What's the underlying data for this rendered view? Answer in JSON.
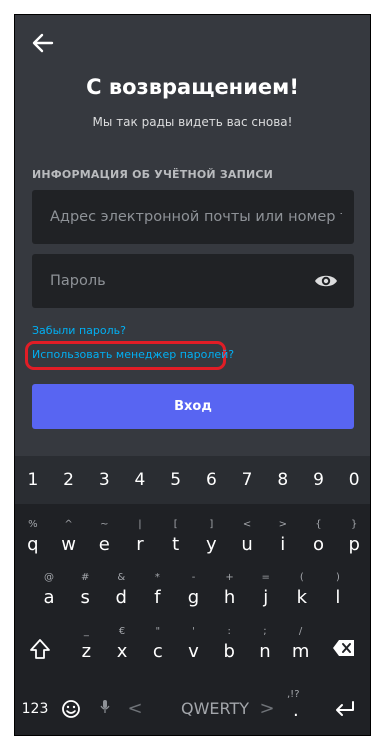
{
  "header": {
    "back_icon": "arrow-left-icon",
    "title": "С возвращением!",
    "subtitle": "Мы так рады видеть вас снова!"
  },
  "form": {
    "section_label": "ИНФОРМАЦИЯ ОБ УЧЁТНОЙ ЗАПИСИ",
    "email_placeholder": "Адрес электронной почты или номер телефона",
    "password_placeholder": "Пароль",
    "password_toggle_icon": "eye-icon",
    "forgot_password": "Забыли пароль?",
    "password_manager": "Использовать менеджер паролей?",
    "login_button": "Вход"
  },
  "colors": {
    "background": "#36393f",
    "field": "#202225",
    "link": "#00b0f4",
    "button": "#5865f2",
    "highlight": "#e11d26"
  },
  "keyboard": {
    "numbers": [
      "1",
      "2",
      "3",
      "4",
      "5",
      "6",
      "7",
      "8",
      "9",
      "0"
    ],
    "row1": [
      {
        "hint": "%",
        "key": "q"
      },
      {
        "hint": "^",
        "key": "w"
      },
      {
        "hint": "~",
        "key": "e"
      },
      {
        "hint": "|",
        "key": "r"
      },
      {
        "hint": "[",
        "key": "t"
      },
      {
        "hint": "]",
        "key": "y"
      },
      {
        "hint": "<",
        "key": "u"
      },
      {
        "hint": ">",
        "key": "i"
      },
      {
        "hint": "{",
        "key": "o"
      },
      {
        "hint": "}",
        "key": "p"
      }
    ],
    "row2": [
      {
        "hint": "@",
        "key": "a"
      },
      {
        "hint": "#",
        "key": "s"
      },
      {
        "hint": "&",
        "key": "d"
      },
      {
        "hint": "*",
        "key": "f"
      },
      {
        "hint": "-",
        "key": "g"
      },
      {
        "hint": "+",
        "key": "h"
      },
      {
        "hint": "=",
        "key": "j"
      },
      {
        "hint": "(",
        "key": "k"
      },
      {
        "hint": ")",
        "key": "l"
      }
    ],
    "row3": [
      {
        "hint": "_",
        "key": "z"
      },
      {
        "hint": "€",
        "key": "x"
      },
      {
        "hint": "\"",
        "key": "c"
      },
      {
        "hint": "'",
        "key": "v"
      },
      {
        "hint": ":",
        "key": "b"
      },
      {
        "hint": ";",
        "key": "n"
      },
      {
        "hint": "/",
        "key": "m"
      }
    ],
    "shift_icon": "shift-icon",
    "backspace_icon": "backspace-icon",
    "mode_key": "123",
    "emoji_icon": "emoji-icon",
    "mic_icon": "mic-icon",
    "left_arrow": "<",
    "layout_label": "QWERTY",
    "right_arrow": ">",
    "punct_top": ",!?",
    "punct_bottom": ".",
    "enter_icon": "enter-icon"
  }
}
